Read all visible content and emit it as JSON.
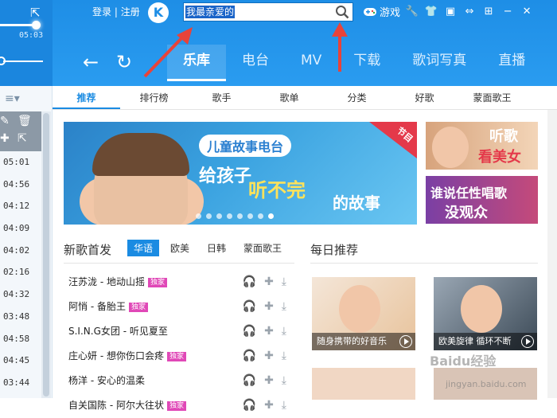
{
  "player": {
    "time": "05:03"
  },
  "header": {
    "login": "登录",
    "separator": "|",
    "register": "注册",
    "logo_letter": "K",
    "search_value": "我最亲爱的",
    "game_label": "游戏"
  },
  "main_tabs": [
    "乐库",
    "电台",
    "MV",
    "下载",
    "歌词写真",
    "直播"
  ],
  "sub_tabs": [
    "推荐",
    "排行榜",
    "歌手",
    "歌单",
    "分类",
    "好歌",
    "蒙面歌王"
  ],
  "sidebar": {
    "durations": [
      "05:01",
      "04:56",
      "04:12",
      "04:09",
      "04:02",
      "02:16",
      "04:32",
      "03:48",
      "04:58",
      "04:45",
      "03:44"
    ]
  },
  "banner": {
    "title": "儿童故事电台",
    "line1": "给孩子",
    "line2": "听不完",
    "line3": "的故事",
    "tag": "节目",
    "dots": 8,
    "active_dot": 7
  },
  "side_ads": {
    "ad1_line1": "听歌",
    "ad1_line2": "看美女",
    "ad2_line1": "谁说任性唱歌",
    "ad2_line2": "没观众"
  },
  "new_songs": {
    "title": "新歌首发",
    "tabs": [
      "华语",
      "欧美",
      "日韩",
      "蒙面歌王"
    ],
    "items": [
      {
        "title": "汪苏泷 - 地动山摇",
        "badge": "独家"
      },
      {
        "title": "阿悄 - 备胎王",
        "badge": "独家"
      },
      {
        "title": "S.I.N.G女团 - 听见夏至",
        "badge": ""
      },
      {
        "title": "庄心妍 - 想你伤口会疼",
        "badge": "独家"
      },
      {
        "title": "杨洋 - 安心的温柔",
        "badge": ""
      },
      {
        "title": "自关国陈 - 阿尔大往状",
        "badge": "独家"
      }
    ]
  },
  "daily": {
    "title": "每日推荐",
    "cards": [
      {
        "caption": "随身携带的好音乐"
      },
      {
        "caption": "欧美旋律 循环不断"
      }
    ]
  },
  "watermark": "Baidu经验",
  "watermark_sub": "jingyan.baidu.com",
  "colors": {
    "accent": "#1a8be2",
    "topbar": "#1e8ee6",
    "badge": "#e048b7",
    "arrow": "#e8433a"
  }
}
